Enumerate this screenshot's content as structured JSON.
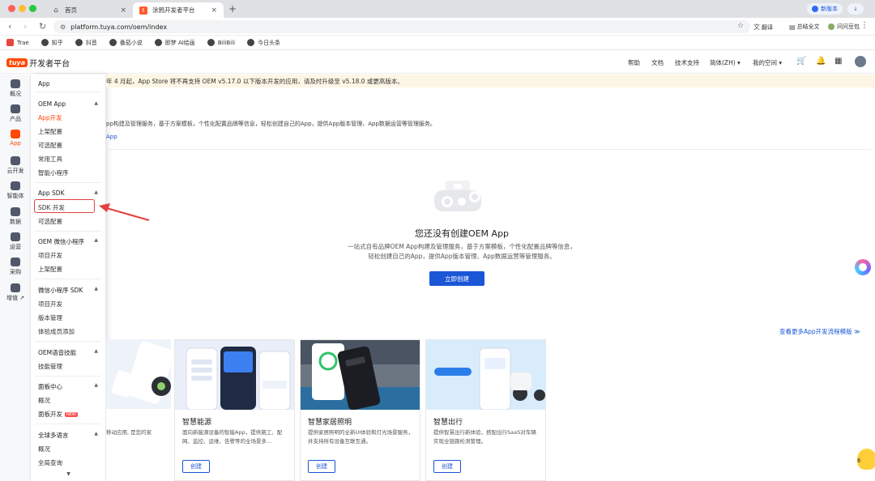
{
  "browser": {
    "tabs": [
      {
        "label": "首页",
        "icon": "home-icon"
      },
      {
        "label": "涂鸦开发者平台",
        "icon": "tuya-favicon"
      }
    ],
    "new_version": "新版本",
    "profile_chip": "⇣",
    "url": "platform.tuya.com/oem/index",
    "translate": "翻译",
    "summarize": "总结全文",
    "user": "问问豆包",
    "bookmarks": [
      {
        "label": "Trae"
      },
      {
        "label": "知乎"
      },
      {
        "label": "抖音"
      },
      {
        "label": "番茄小说"
      },
      {
        "label": "即梦 AI绘画"
      },
      {
        "label": "BiliBili"
      },
      {
        "label": "今日头条"
      }
    ]
  },
  "header": {
    "logo_mark": "tuya",
    "logo_text": "开发者平台",
    "nav": {
      "help": "帮助",
      "docs": "文档",
      "support": "技术支持",
      "language": "简体(ZH) ▾",
      "space": "我的空间 ▾"
    }
  },
  "rail": [
    {
      "label": "概况",
      "active": false
    },
    {
      "label": "产品",
      "active": false
    },
    {
      "label": "App",
      "active": true
    },
    {
      "label": "云开发",
      "active": false
    },
    {
      "label": "智能体",
      "active": false
    },
    {
      "label": "数据",
      "active": false
    },
    {
      "label": "运营",
      "active": false
    },
    {
      "label": "采购",
      "active": false
    },
    {
      "label": "增值 ↗",
      "active": false
    }
  ],
  "flyout": {
    "title": "App",
    "groups": [
      {
        "label": "OEM App",
        "items": [
          "App开发",
          "上架配置",
          "可选配置",
          "常用工具",
          "智能小程序"
        ]
      },
      {
        "label": "App SDK",
        "items": [
          "SDK 开发",
          "可选配置"
        ]
      },
      {
        "label": "OEM 微信小程序",
        "items": [
          "项目开发",
          "上架配置"
        ]
      },
      {
        "label": "微信小程序 SDK",
        "items": [
          "项目开发",
          "版本管理",
          "体验成员添加"
        ]
      },
      {
        "label": "OEM语音技能",
        "items": [
          "技能管理"
        ]
      },
      {
        "label": "面板中心",
        "items": [
          "概况",
          "面板开发"
        ]
      },
      {
        "label": "全球多语言",
        "items": [
          "概况",
          "全局查询"
        ]
      }
    ],
    "badge_new": "NEW",
    "more": "▼"
  },
  "main": {
    "notice": "年 4 月起，App Store 将不再支持 OEM v5.17.0 以下版本开发的应用，请及时升级至 v5.18.0 或更高版本。",
    "intro": "pp构建及管理服务，基于方案模板，个性化配置品牌等信息，轻松创建自己的App，提供App版本管理、App数据运营等管理服务。",
    "intro_link": "App",
    "empty_title": "您还没有创建OEM App",
    "empty_desc_1": "一站式自有品牌OEM App构建及管理服务，基于方案模板，个性化配置品牌等信息，",
    "empty_desc_2": "轻松创建自己的App，提供App版本管理、App数据运营等管理服务。",
    "create_button": "立即创建",
    "see_more": "查看更多App开发流程模版 ≫",
    "partial_card_desc": "移动应用, 是您的家",
    "cards": [
      {
        "title": "智慧能源",
        "desc": "面向新能源设备的智能App，提供施工、配网、监控、运维、告警等的全场景多...",
        "button": "创建"
      },
      {
        "title": "智慧家居照明",
        "desc": "提供家居照明的全新UI体验和灯光场景服务，并支持所有设备互联互通。",
        "button": "创建"
      },
      {
        "title": "智慧出行",
        "desc": "提供智慧出行新体验，搭配出行SaaS对车辆实现全链路检测管理。",
        "button": "创建"
      }
    ],
    "float_num": "6"
  },
  "colors": {
    "brand": "#ff4800",
    "primary": "#1a56d6",
    "notice_bg": "#fdf6e4",
    "highlight_red": "#e64040"
  }
}
